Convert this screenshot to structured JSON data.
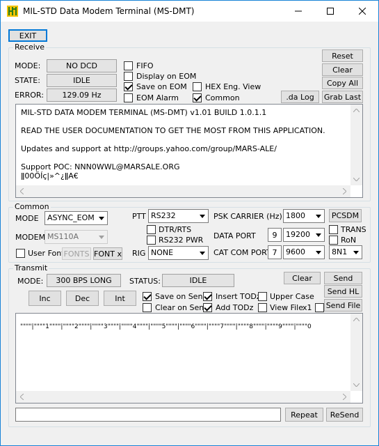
{
  "window": {
    "title": "MIL-STD Data Modem Terminal (MS-DMT)",
    "exit_label": "EXIT"
  },
  "receive": {
    "group_label": "Receive",
    "mode_label": "MODE:",
    "mode_value": "NO DCD",
    "state_label": "STATE:",
    "state_value": "IDLE",
    "error_label": "ERROR:",
    "error_value": "129.09 Hz",
    "cb_fifo": "FIFO",
    "cb_display_eom": "Display on EOM",
    "cb_save_eom": "Save on EOM",
    "cb_eom_alarm": "EOM Alarm",
    "cb_hex": "HEX Eng. View",
    "cb_common": "Common",
    "btn_reset": "Reset",
    "btn_clear": "Clear",
    "btn_copy_all": "Copy All",
    "btn_grab_last": "Grab Last",
    "btn_da_log": ".da Log",
    "text_lines": [
      "MIL-STD DATA MODEM TERMINAL (MS-DMT) v1.01 BUILD 1.0.1.1",
      "READ THE USER DOCUMENTATION TO GET THE MOST FROM THIS APPLICATION.",
      "Updates and support at http://groups.yahoo.com/group/MARS-ALE/",
      "Support POC: NNN0WWL@MARSALE.ORG",
      "ǁ00ÖÍç|»^¿ǁA€"
    ]
  },
  "common": {
    "group_label": "Common",
    "mode_label": "MODE",
    "mode_value": "ASYNC_EOM",
    "modem_label": "MODEM",
    "modem_value": "MS110A",
    "user_font": "User Font",
    "btn_fonts": "FONTS",
    "btn_font_x": "FONT x",
    "ptt_label": "PTT",
    "ptt_value": "RS232",
    "cb_dtr": "DTR/RTS",
    "cb_rs232": "RS232 PWR",
    "rig_label": "RIG",
    "rig_value": "NONE",
    "psk_label": "PSK CARRIER (Hz)",
    "psk_value": "1800",
    "btn_pcsdm": "PCSDM",
    "data_port_label": "DATA PORT",
    "data_port_num": "9",
    "data_port_baud": "19200",
    "cb_trans": "TRANS",
    "cb_ron": "RoN",
    "cat_label": "CAT COM PORT",
    "cat_num": "7",
    "cat_baud": "9600",
    "cat_format": "8N1"
  },
  "transmit": {
    "group_label": "Transmit",
    "mode_label": "MODE:",
    "mode_value": "300 BPS LONG",
    "status_label": "STATUS:",
    "status_value": "IDLE",
    "btn_inc": "Inc",
    "btn_dec": "Dec",
    "btn_int": "Int",
    "cb_save_send": "Save on Send",
    "cb_clear_send": "Clear on Send",
    "cb_insert_todz": "Insert TODz",
    "cb_add_todz": "Add TODz",
    "cb_upper_case": "Upper Case",
    "cb_view_file": "View File",
    "x1_label": "x1",
    "btn_clear": "Clear",
    "btn_send": "Send",
    "btn_send_hl": "Send HL",
    "btn_send_file": "Send File",
    "ruler": "\"\"\"\"|\"\"\"\"1\"\"\"\"|\"\"\"\"2\"\"\"\"|\"\"\"\"3\"\"\"\"|\"\"\"\"4\"\"\"\"|\"\"\"\"5\"\"\"\"|\"\"\"\"6\"\"\"\"|\"\"\"\"7\"\"\"\"|\"\"\"\"8\"\"\"\"|\"\"\"\"9\"\"\"\"|\"\"\"\"0",
    "repeat_input": "",
    "btn_repeat": "Repeat",
    "btn_resend": "ReSend"
  }
}
